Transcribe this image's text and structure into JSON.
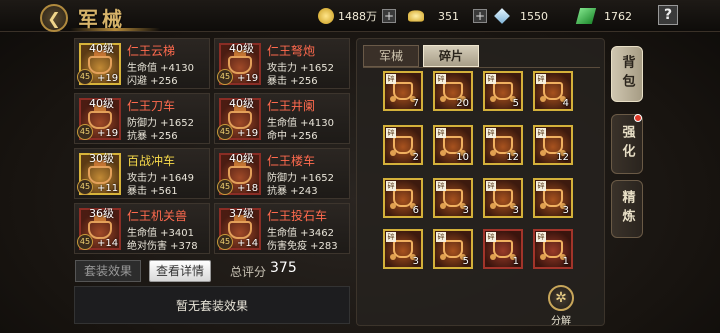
{
  "header": {
    "title": "军械",
    "back_icon": "back-arrow-icon"
  },
  "resources": [
    {
      "icon": "gold-coin-icon",
      "value": "1488万",
      "has_plus": true
    },
    {
      "icon": "gold-ingot-icon",
      "value": "351",
      "has_plus": true
    },
    {
      "icon": "crystal-icon",
      "value": "1550",
      "has_plus": false
    },
    {
      "icon": "jade-icon",
      "value": "1762",
      "has_plus": false
    }
  ],
  "help_label": "?",
  "equipment": [
    {
      "level": "40级",
      "name": "仁王云梯",
      "name_color": "red",
      "stat1": "生命值 +4130",
      "stat2": "闪避 +256",
      "badge": "45",
      "plus": "+19",
      "frame": "gold"
    },
    {
      "level": "40级",
      "name": "仁王弩炮",
      "name_color": "red",
      "stat1": "攻击力 +1652",
      "stat2": "暴击 +256",
      "badge": "45",
      "plus": "+19",
      "frame": "red"
    },
    {
      "level": "40级",
      "name": "仁王刀车",
      "name_color": "red",
      "stat1": "防御力 +1652",
      "stat2": "抗暴 +256",
      "badge": "45",
      "plus": "+19",
      "frame": "red"
    },
    {
      "level": "40级",
      "name": "仁王井阑",
      "name_color": "red",
      "stat1": "生命值 +4130",
      "stat2": "命中 +256",
      "badge": "45",
      "plus": "+19",
      "frame": "red"
    },
    {
      "level": "30级",
      "name": "百战冲车",
      "name_color": "yellow",
      "stat1": "攻击力 +1649",
      "stat2": "暴击 +561",
      "badge": "45",
      "plus": "+11",
      "frame": "gold"
    },
    {
      "level": "40级",
      "name": "仁王楼车",
      "name_color": "red",
      "stat1": "防御力 +1652",
      "stat2": "抗暴 +243",
      "badge": "45",
      "plus": "+18",
      "frame": "red"
    },
    {
      "level": "36级",
      "name": "仁王机关兽",
      "name_color": "red",
      "stat1": "生命值 +3401",
      "stat2": "绝对伤害 +378",
      "badge": "45",
      "plus": "+14",
      "frame": "red"
    },
    {
      "level": "37级",
      "name": "仁王投石车",
      "name_color": "red",
      "stat1": "生命值 +3462",
      "stat2": "伤害免疫 +283",
      "badge": "45",
      "plus": "+14",
      "frame": "red"
    }
  ],
  "set_tab_label": "套装效果",
  "details_button_label": "查看详情",
  "score_label": "总评分",
  "score_value": "375",
  "set_effect_text": "暂无套装效果",
  "tabs": {
    "arms": "军械",
    "fragments": "碎片"
  },
  "fragments": [
    {
      "tag": "碎",
      "count": "7",
      "frame": "gold"
    },
    {
      "tag": "碎",
      "count": "20",
      "frame": "gold"
    },
    {
      "tag": "碎",
      "count": "5",
      "frame": "gold"
    },
    {
      "tag": "碎",
      "count": "4",
      "frame": "gold"
    },
    {
      "tag": "碎",
      "count": "2",
      "frame": "gold"
    },
    {
      "tag": "碎",
      "count": "10",
      "frame": "gold"
    },
    {
      "tag": "碎",
      "count": "12",
      "frame": "gold"
    },
    {
      "tag": "碎",
      "count": "12",
      "frame": "gold"
    },
    {
      "tag": "碎",
      "count": "6",
      "frame": "gold"
    },
    {
      "tag": "碎",
      "count": "3",
      "frame": "gold"
    },
    {
      "tag": "碎",
      "count": "3",
      "frame": "gold"
    },
    {
      "tag": "碎",
      "count": "3",
      "frame": "gold"
    },
    {
      "tag": "碎",
      "count": "3",
      "frame": "gold"
    },
    {
      "tag": "碎",
      "count": "5",
      "frame": "gold"
    },
    {
      "tag": "碎",
      "count": "1",
      "frame": "red"
    },
    {
      "tag": "碎",
      "count": "1",
      "frame": "red"
    }
  ],
  "decompose_label": "分解",
  "side_tabs": {
    "bag": "背包",
    "enhance": "强化",
    "refine": "精炼"
  }
}
